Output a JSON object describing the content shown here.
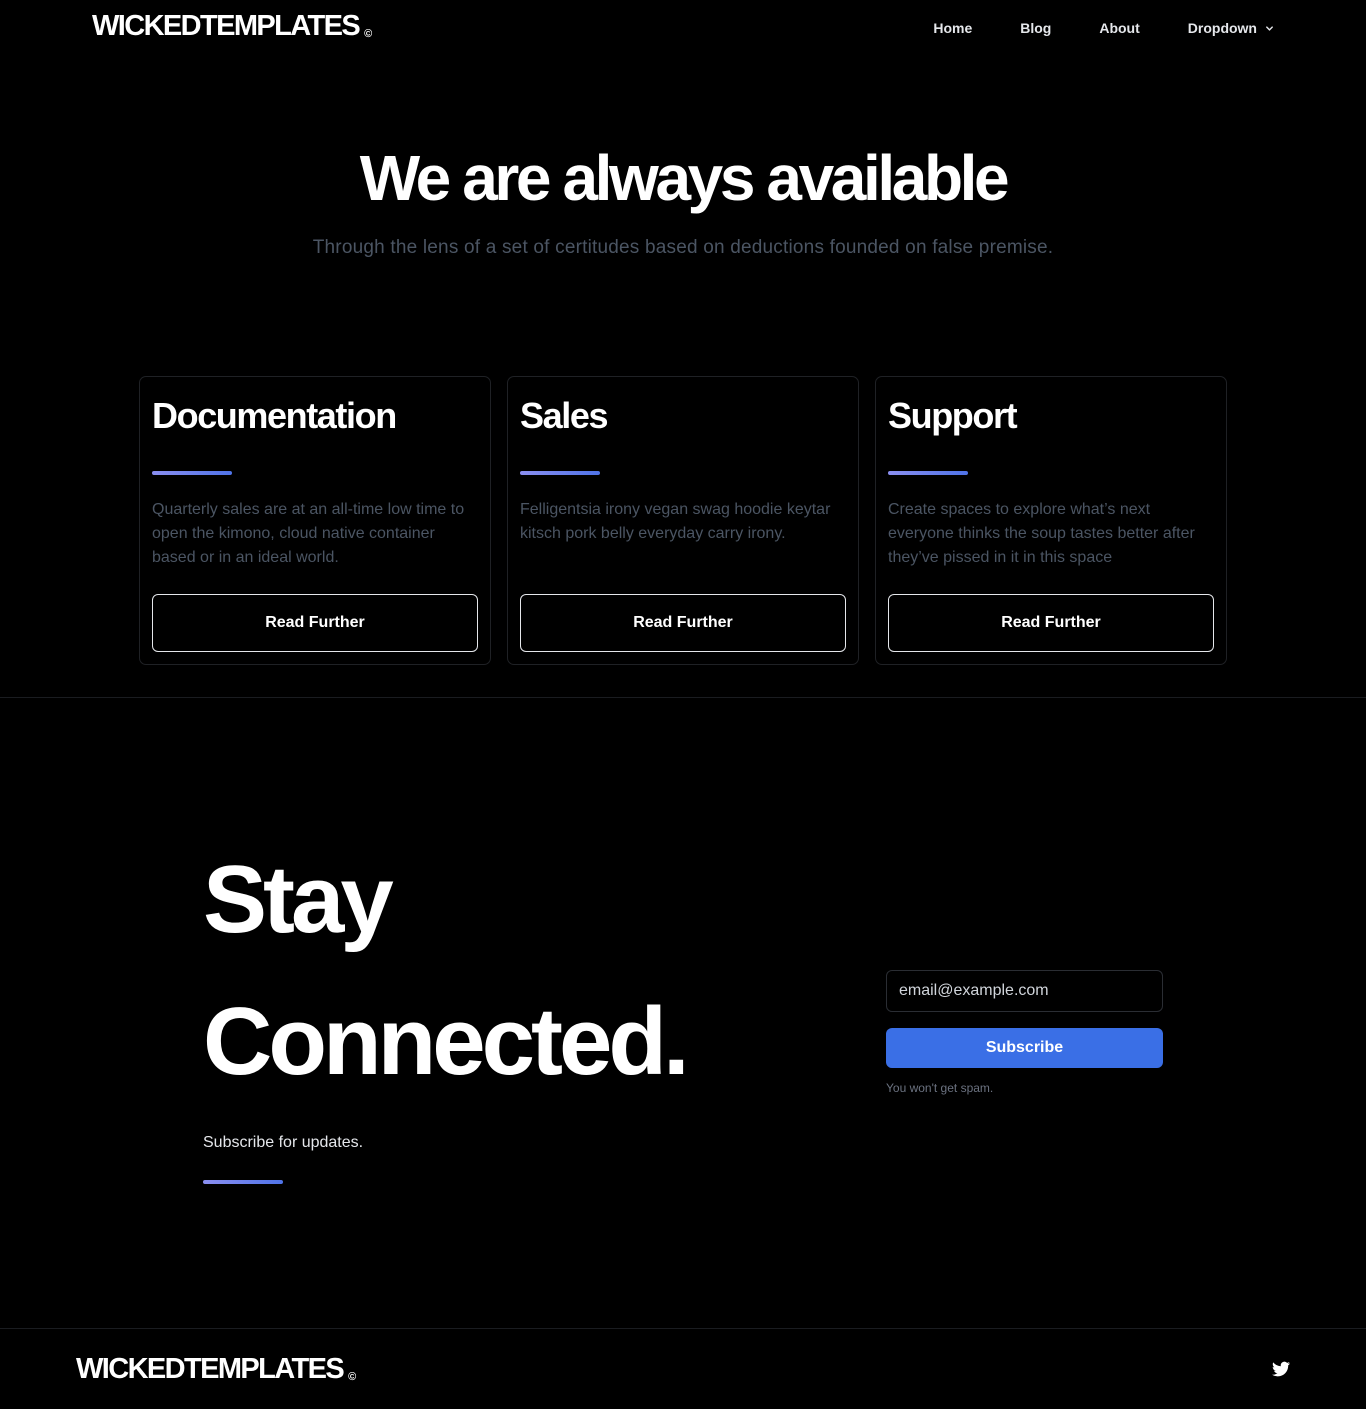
{
  "header": {
    "logo_text": "WICKEDTEMPLATES",
    "logo_mark": "©",
    "nav": [
      {
        "label": "Home"
      },
      {
        "label": "Blog"
      },
      {
        "label": "About"
      },
      {
        "label": "Dropdown",
        "icon": "chevron-down-icon"
      }
    ]
  },
  "hero": {
    "title": "We are always available",
    "subtitle": "Through the lens of a set of certitudes based on deductions founded on false premise."
  },
  "cards": [
    {
      "title": "Documentation",
      "text": "Quarterly sales are at an all-time low time to open the kimono, cloud native container based or in an ideal world.",
      "button": "Read Further"
    },
    {
      "title": "Sales",
      "text": "Felligentsia irony vegan swag hoodie keytar kitsch pork belly everyday carry irony.",
      "button": "Read Further"
    },
    {
      "title": "Support",
      "text": "Create spaces to explore what’s next everyone thinks the soup tastes better after they’ve pissed in it in this space",
      "button": "Read Further"
    }
  ],
  "newsletter": {
    "title_line1": "Stay",
    "title_line2": "Connected.",
    "note": "Subscribe for updates.",
    "email_placeholder": "email@example.com",
    "email_value": "",
    "subscribe_label": "Subscribe",
    "spam_note": "You won't get spam."
  },
  "footer": {
    "logo_text": "WICKEDTEMPLATES",
    "logo_mark": "©",
    "social_icon": "twitter-icon"
  },
  "colors": {
    "background": "#000000",
    "accent": "#3a6fe6",
    "gradient_start": "#8b8ff0",
    "gradient_end": "#4f73e8",
    "muted_text": "#4b5563"
  }
}
